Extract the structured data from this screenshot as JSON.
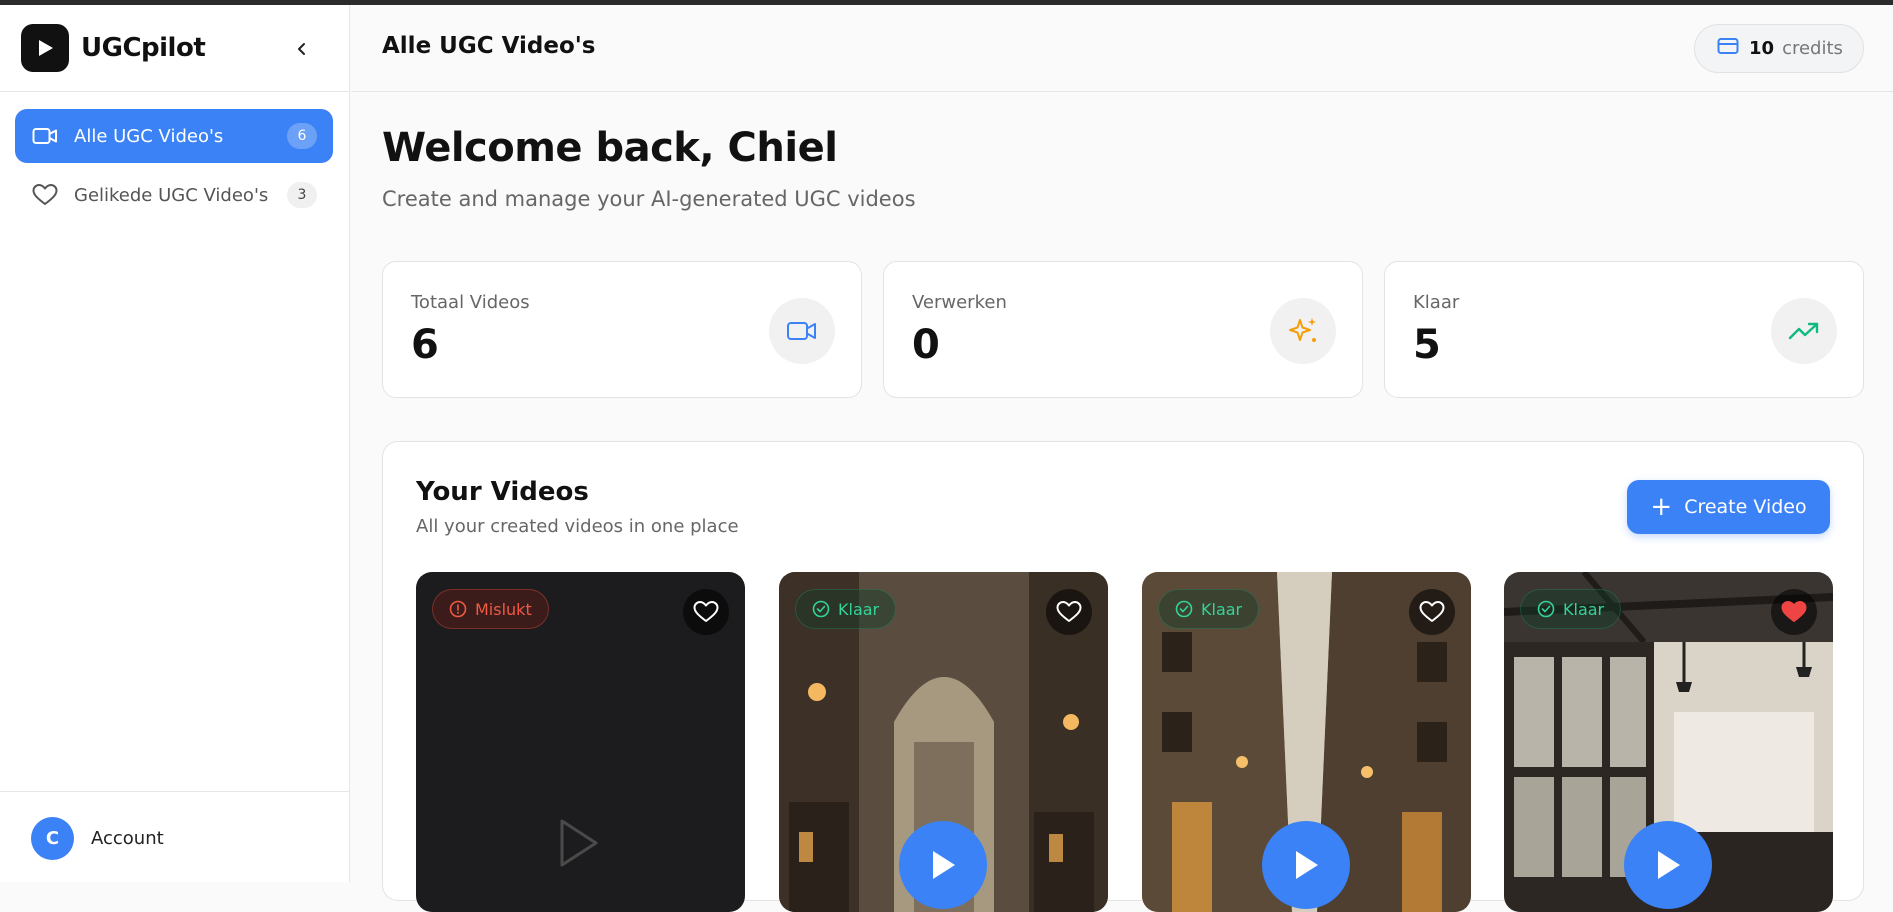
{
  "app": {
    "name": "UGCpilot"
  },
  "sidebar": {
    "items": [
      {
        "label": "Alle UGC Video's",
        "count": "6",
        "icon": "video-icon",
        "active": true
      },
      {
        "label": "Gelikede UGC Video's",
        "count": "3",
        "icon": "heart-icon",
        "active": false
      }
    ],
    "account": {
      "initial": "C",
      "label": "Account"
    }
  },
  "header": {
    "title": "Alle UGC Video's",
    "credits": {
      "count": "10",
      "label": "credits",
      "icon": "credit-card-icon"
    }
  },
  "main": {
    "welcome_title": "Welcome back, Chiel",
    "welcome_subtitle": "Create and manage your AI-generated UGC videos",
    "stats": [
      {
        "label": "Totaal Videos",
        "value": "6",
        "icon": "video-icon",
        "color": "#3b82f6"
      },
      {
        "label": "Verwerken",
        "value": "0",
        "icon": "sparkles-icon",
        "color": "#f59e0b"
      },
      {
        "label": "Klaar",
        "value": "5",
        "icon": "trending-up-icon",
        "color": "#10b981"
      }
    ],
    "videos": {
      "title": "Your Videos",
      "subtitle": "All your created videos in one place",
      "create_label": "Create Video",
      "cards": [
        {
          "status": "Mislukt",
          "status_type": "failed",
          "liked": false,
          "scene": "dark-placeholder"
        },
        {
          "status": "Klaar",
          "status_type": "ready",
          "liked": false,
          "scene": "archway-street"
        },
        {
          "status": "Klaar",
          "status_type": "ready",
          "liked": false,
          "scene": "narrow-street"
        },
        {
          "status": "Klaar",
          "status_type": "ready",
          "liked": true,
          "scene": "industrial-gym"
        }
      ]
    }
  },
  "colors": {
    "accent": "#3b82f6",
    "failed": "#ef5a44",
    "ready": "#34d399",
    "liked": "#ef4444"
  }
}
